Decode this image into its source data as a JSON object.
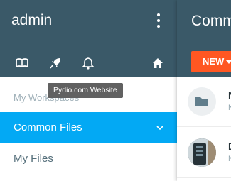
{
  "sidebar": {
    "user_name": "admin",
    "tooltip": "Pydio.com Website",
    "section_title": "My Workspaces",
    "workspaces": [
      {
        "label": "Common Files",
        "active": true
      },
      {
        "label": "My Files",
        "active": false
      }
    ],
    "toolbar_icons": [
      "book-icon",
      "rocket-icon",
      "bell-icon",
      "home-icon"
    ]
  },
  "main": {
    "title": "Common Files",
    "new_button_label": "NEW",
    "rows": [
      {
        "title": "N",
        "subtitle": "N",
        "icon": "folder-icon"
      },
      {
        "title": "D",
        "subtitle": "N",
        "icon": "image-thumbnail"
      }
    ]
  },
  "colors": {
    "header": "#3a5968",
    "active": "#03a9f4",
    "new_button": "#ff5722",
    "tooltip": "#616161"
  }
}
